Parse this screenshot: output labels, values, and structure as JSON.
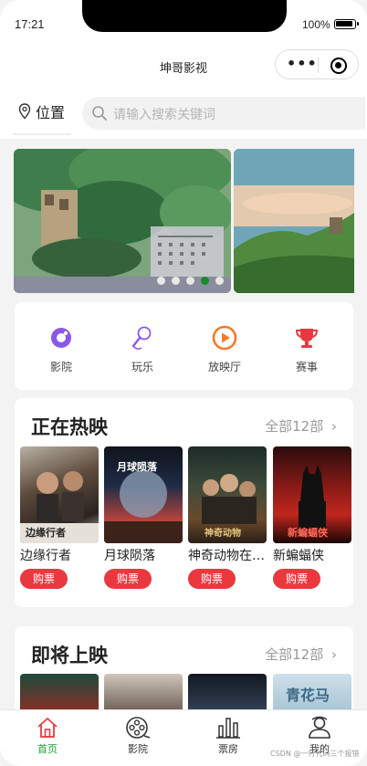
{
  "status_bar": {
    "time": "17:21",
    "battery": "100%"
  },
  "nav": {
    "title": "坤哥影视"
  },
  "search": {
    "location_label": "位置",
    "placeholder": "请输入搜索关键词"
  },
  "banner": {
    "slide_count": 5,
    "active_index": 3
  },
  "categories": [
    {
      "label": "影院",
      "icon": "cinema-icon"
    },
    {
      "label": "玩乐",
      "icon": "microphone-icon"
    },
    {
      "label": "放映厅",
      "icon": "play-icon"
    },
    {
      "label": "赛事",
      "icon": "trophy-icon"
    }
  ],
  "now_showing": {
    "title": "正在热映",
    "more": "全部12部",
    "movies": [
      {
        "title": "边缘行者",
        "buy": "购票",
        "poster_text": "边缘行者"
      },
      {
        "title": "月球陨落",
        "buy": "购票",
        "poster_text": "月球陨落"
      },
      {
        "title": "神奇动物在…",
        "buy": "购票",
        "poster_text": "神奇动物"
      },
      {
        "title": "新蝙蝠侠",
        "buy": "购票",
        "poster_text": "新蝙蝠侠"
      }
    ]
  },
  "coming_soon": {
    "title": "即将上映",
    "more": "全部12部",
    "posters": [
      {
        "poster_text": ""
      },
      {
        "poster_text": ""
      },
      {
        "poster_text": ""
      },
      {
        "poster_text": "青花马"
      }
    ]
  },
  "tabbar": [
    {
      "label": "首页",
      "icon": "home-icon",
      "active": true
    },
    {
      "label": "影院",
      "icon": "film-reel-icon",
      "active": false
    },
    {
      "label": "票房",
      "icon": "bar-chart-icon",
      "active": false
    },
    {
      "label": "我的",
      "icon": "user-icon",
      "active": false
    }
  ],
  "watermark": "CSDN @一行代码三个报错",
  "colors": {
    "accent_red": "#e9393f",
    "active_green": "#1a9f33",
    "dot_active": "#1b8a2e",
    "purple": "#8b57e8",
    "orange": "#f5792a"
  }
}
